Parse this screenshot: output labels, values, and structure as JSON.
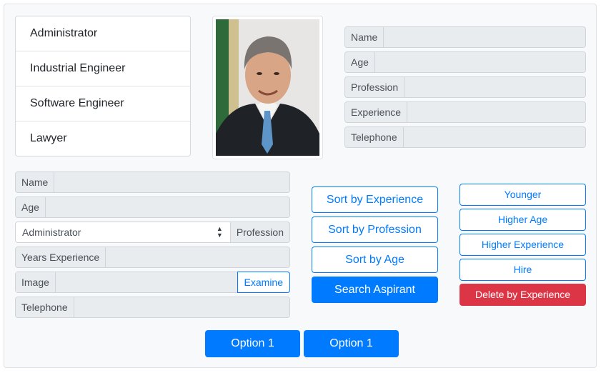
{
  "professions": [
    "Administrator",
    "Industrial Engineer",
    "Software Engineer",
    "Lawyer"
  ],
  "photo": {
    "icon": "candidate-portrait"
  },
  "detail_labels": {
    "name": "Name",
    "age": "Age",
    "profession": "Profession",
    "experience": "Experience",
    "telephone": "Telephone"
  },
  "form": {
    "name_label": "Name",
    "age_label": "Age",
    "profession_selected": "Administrator",
    "profession_label": "Profession",
    "years_experience_label": "Years Experience",
    "image_label": "Image",
    "examine_label": "Examine",
    "telephone_label": "Telephone"
  },
  "sort_buttons": {
    "experience": "Sort by Experience",
    "profession": "Sort by Profession",
    "age": "Sort by Age",
    "search": "Search Aspirant"
  },
  "filter_buttons": {
    "younger": "Younger",
    "higher_age": "Higher Age",
    "higher_experience": "Higher Experience",
    "hire": "Hire",
    "delete_by_experience": "Delete by Experience"
  },
  "option_buttons": [
    "Option 1",
    "Option 1"
  ],
  "colors": {
    "primary": "#007bff",
    "danger": "#dc3545",
    "addon_bg": "#e9ecef"
  }
}
